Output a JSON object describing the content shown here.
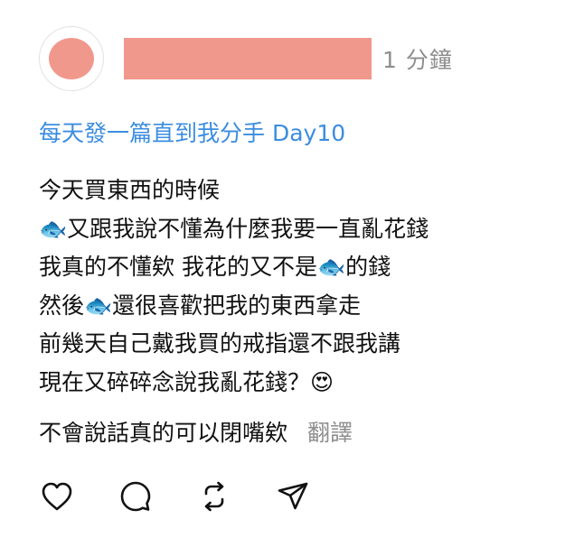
{
  "post": {
    "time": "1 分鐘",
    "tag_line": "每天發一篇直到我分手 Day10",
    "lines": [
      "今天買東西的時候",
      "🐟又跟我說不懂為什麼我要一直亂花錢",
      "我真的不懂欸 我花的又不是🐟的錢",
      "然後🐟還很喜歡把我的東西拿走",
      "前幾天自己戴我買的戒指還不跟我講",
      "現在又碎碎念說我亂花錢？😍"
    ],
    "last_line": "不會說話真的可以閉嘴欸",
    "translate_label": "翻譯"
  },
  "actions": {
    "like": "heart-icon",
    "comment": "comment-bubble-icon",
    "repost": "repost-icon",
    "share": "send-icon"
  },
  "colors": {
    "redaction": "#f1988c",
    "link": "#3b8de0",
    "muted": "#8e8e8e"
  }
}
